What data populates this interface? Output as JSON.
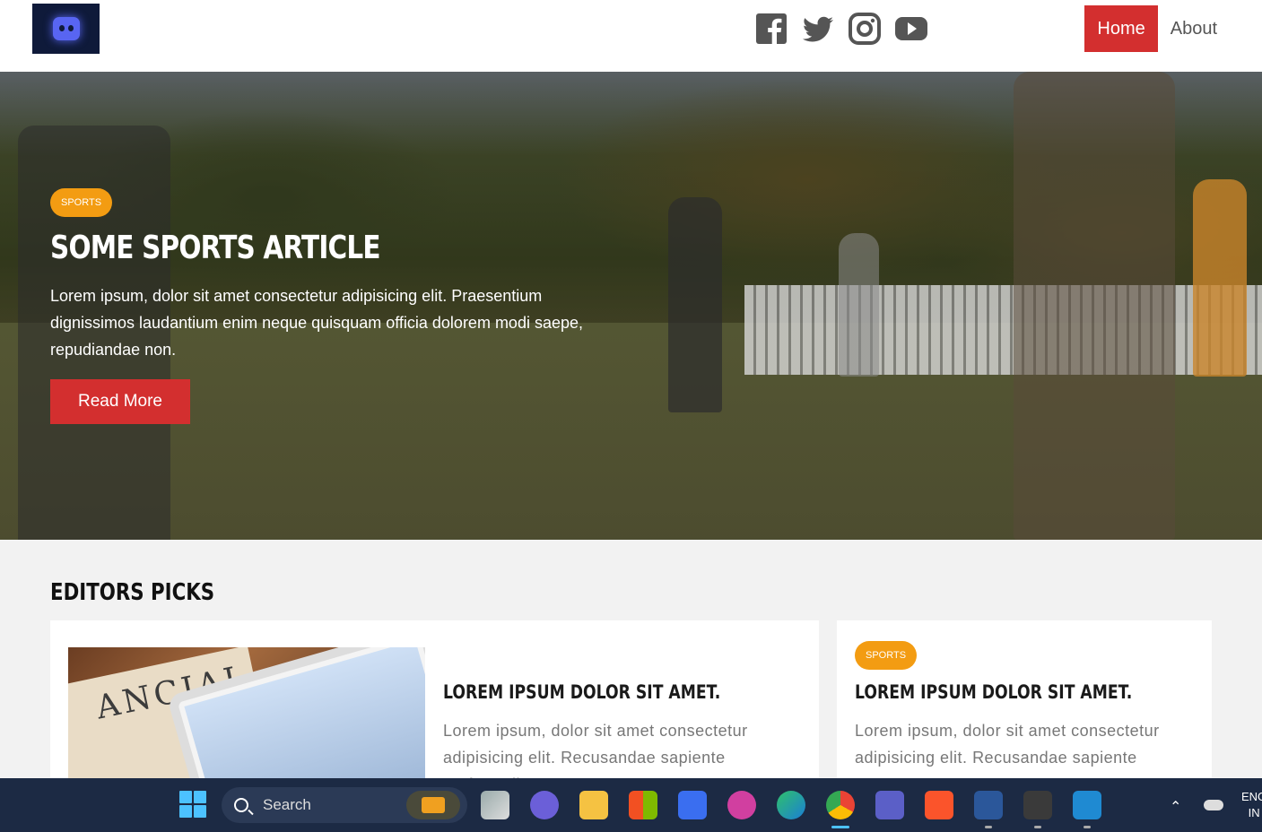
{
  "header": {
    "logo_icon": "discord-logo-icon",
    "socials": [
      "facebook-icon",
      "twitter-icon",
      "instagram-icon",
      "youtube-icon"
    ],
    "nav": [
      {
        "label": "Home",
        "active": true
      },
      {
        "label": "About",
        "active": false
      }
    ]
  },
  "hero": {
    "badge": "SPORTS",
    "title": "SOME SPORTS ARTICLE",
    "text": "Lorem ipsum, dolor sit amet consectetur adipisicing elit. Praesentium dignissimos laudantium enim neque quisquam officia dolorem modi saepe, repudiandae non.",
    "button": "Read More"
  },
  "editors_picks": {
    "title": "EDITORS PICKS",
    "cards": [
      {
        "title": "LOREM IPSUM DOLOR SIT AMET.",
        "text": "Lorem ipsum, dolor sit amet consectetur adipisicing elit. Recusandae sapiente perferendis",
        "image_text": "ANCIAL"
      },
      {
        "badge": "SPORTS",
        "title": "LOREM IPSUM DOLOR SIT AMET.",
        "text": "Lorem ipsum, dolor sit amet consectetur adipisicing elit. Recusandae sapiente"
      }
    ]
  },
  "taskbar": {
    "search_placeholder": "Search",
    "apps": [
      "task-view-icon",
      "chat-icon",
      "file-explorer-icon",
      "store-icon",
      "app-icon",
      "wps-icon",
      "edge-icon",
      "chrome-icon",
      "teams-icon",
      "brave-icon",
      "word-icon",
      "terminal-icon",
      "vscode-icon"
    ],
    "lang_line1": "ENG",
    "lang_line2": "IN"
  },
  "colors": {
    "accent_red": "#d32f2f",
    "badge_orange": "#f39c12",
    "taskbar_bg": "#1c2a44"
  }
}
